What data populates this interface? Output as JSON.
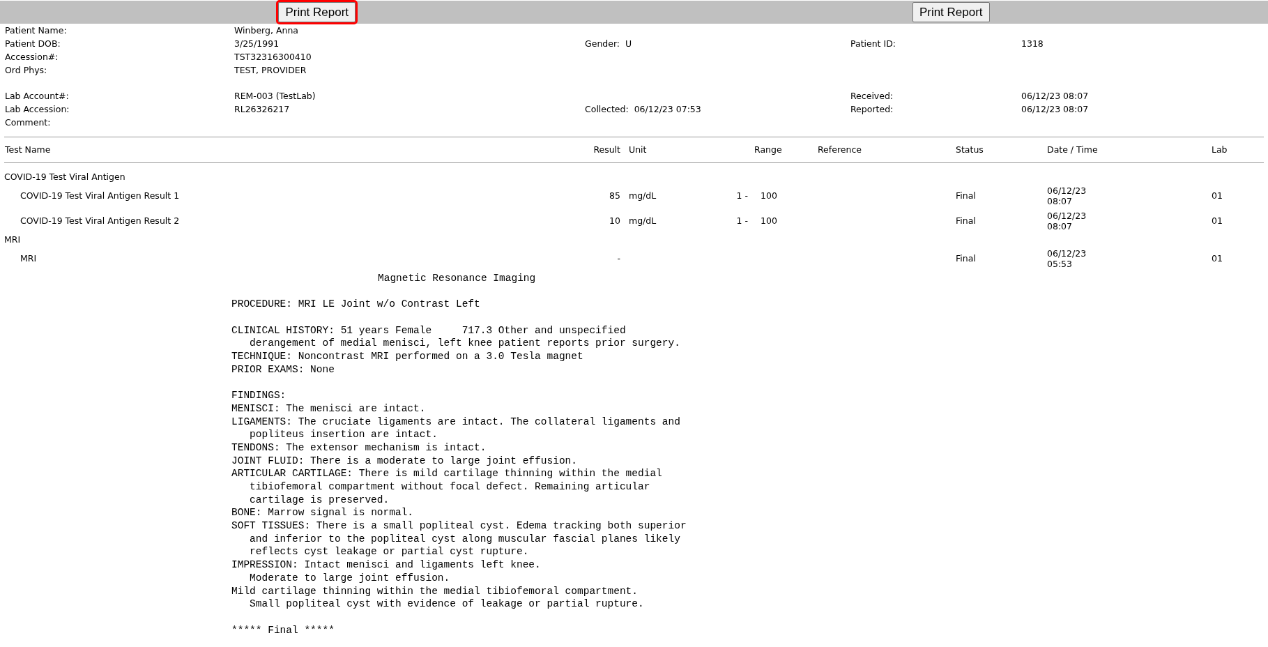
{
  "toolbar": {
    "buttons": [
      {
        "label": "Print Report",
        "highlighted": true
      },
      {
        "label": "Print Report",
        "highlighted": false
      }
    ]
  },
  "patient_info": {
    "groups": [
      {
        "rows": [
          {
            "left_label": "Patient Name:",
            "left_value": "Winberg, Anna"
          },
          {
            "left_label": "Patient DOB:",
            "left_value": "3/25/1991",
            "middle_label": "Gender:",
            "middle_value": "U",
            "right_label": "Patient ID:",
            "right_value": "1318"
          },
          {
            "left_label": "Accession#:",
            "left_value": "TST32316300410"
          },
          {
            "left_label": "Ord Phys:",
            "left_value": "TEST, PROVIDER"
          }
        ]
      },
      {
        "rows": [
          {
            "left_label": "Lab Account#:",
            "left_value": "REM-003 (TestLab)",
            "right_label": "Received:",
            "right_value": "06/12/23 08:07"
          },
          {
            "left_label": "Lab Accession:",
            "left_value": "RL26326217",
            "middle_label": "Collected:",
            "middle_value": "06/12/23 07:53",
            "right_label": "Reported:",
            "right_value": "06/12/23 08:07"
          },
          {
            "left_label": "Comment:"
          }
        ]
      }
    ]
  },
  "results_table": {
    "columns": [
      "Test Name",
      "Result",
      "Unit",
      "Range",
      "Reference",
      "Status",
      "Date / Time",
      "Lab"
    ],
    "groups": [
      {
        "name": "COVID-19 Test Viral Antigen",
        "rows": [
          {
            "test": "COVID-19 Test Viral Antigen Result 1",
            "result": "85",
            "unit": "mg/dL",
            "range_low": "1 -",
            "range_high": "100",
            "status": "Final",
            "date": "06/12/23",
            "time": "08:07",
            "lab": "01"
          },
          {
            "test": "COVID-19 Test Viral Antigen Result 2",
            "result": "10",
            "unit": "mg/dL",
            "range_low": "1 -",
            "range_high": "100",
            "status": "Final",
            "date": "06/12/23",
            "time": "08:07",
            "lab": "01"
          }
        ]
      },
      {
        "name": "MRI",
        "rows": [
          {
            "test": "MRI",
            "result": "-",
            "status": "Final",
            "date": "06/12/23",
            "time": "05:53",
            "lab": "01",
            "report": [
              {
                "kind": "title",
                "text": "Magnetic Resonance Imaging"
              },
              {
                "kind": "blank"
              },
              {
                "kind": "line",
                "text": "PROCEDURE: MRI LE Joint w/o Contrast Left"
              },
              {
                "kind": "blank"
              },
              {
                "kind": "line",
                "text": "CLINICAL HISTORY: 51 years Female     717.3 Other and unspecified"
              },
              {
                "kind": "continuation",
                "text": "derangement of medial menisci, left knee patient reports prior surgery."
              },
              {
                "kind": "line",
                "text": "TECHNIQUE: Noncontrast MRI performed on a 3.0 Tesla magnet"
              },
              {
                "kind": "line",
                "text": "PRIOR EXAMS: None"
              },
              {
                "kind": "blank"
              },
              {
                "kind": "line",
                "text": "FINDINGS:"
              },
              {
                "kind": "line",
                "text": "MENISCI: The menisci are intact."
              },
              {
                "kind": "line",
                "text": "LIGAMENTS: The cruciate ligaments are intact. The collateral ligaments and"
              },
              {
                "kind": "continuation",
                "text": "popliteus insertion are intact."
              },
              {
                "kind": "line",
                "text": "TENDONS: The extensor mechanism is intact."
              },
              {
                "kind": "line",
                "text": "JOINT FLUID: There is a moderate to large joint effusion."
              },
              {
                "kind": "line",
                "text": "ARTICULAR CARTILAGE: There is mild cartilage thinning within the medial"
              },
              {
                "kind": "continuation",
                "text": "tibiofemoral compartment without focal defect. Remaining articular"
              },
              {
                "kind": "continuation",
                "text": "cartilage is preserved."
              },
              {
                "kind": "line",
                "text": "BONE: Marrow signal is normal."
              },
              {
                "kind": "line",
                "text": "SOFT TISSUES: There is a small popliteal cyst. Edema tracking both superior"
              },
              {
                "kind": "continuation",
                "text": "and inferior to the popliteal cyst along muscular fascial planes likely"
              },
              {
                "kind": "continuation",
                "text": "reflects cyst leakage or partial cyst rupture."
              },
              {
                "kind": "line",
                "text": "IMPRESSION: Intact menisci and ligaments left knee."
              },
              {
                "kind": "continuation",
                "text": "Moderate to large joint effusion."
              },
              {
                "kind": "line",
                "text": "Mild cartilage thinning within the medial tibiofemoral compartment."
              },
              {
                "kind": "continuation",
                "text": "Small popliteal cyst with evidence of leakage or partial rupture."
              },
              {
                "kind": "blank"
              },
              {
                "kind": "line",
                "text": "***** Final *****"
              }
            ]
          }
        ]
      }
    ]
  }
}
